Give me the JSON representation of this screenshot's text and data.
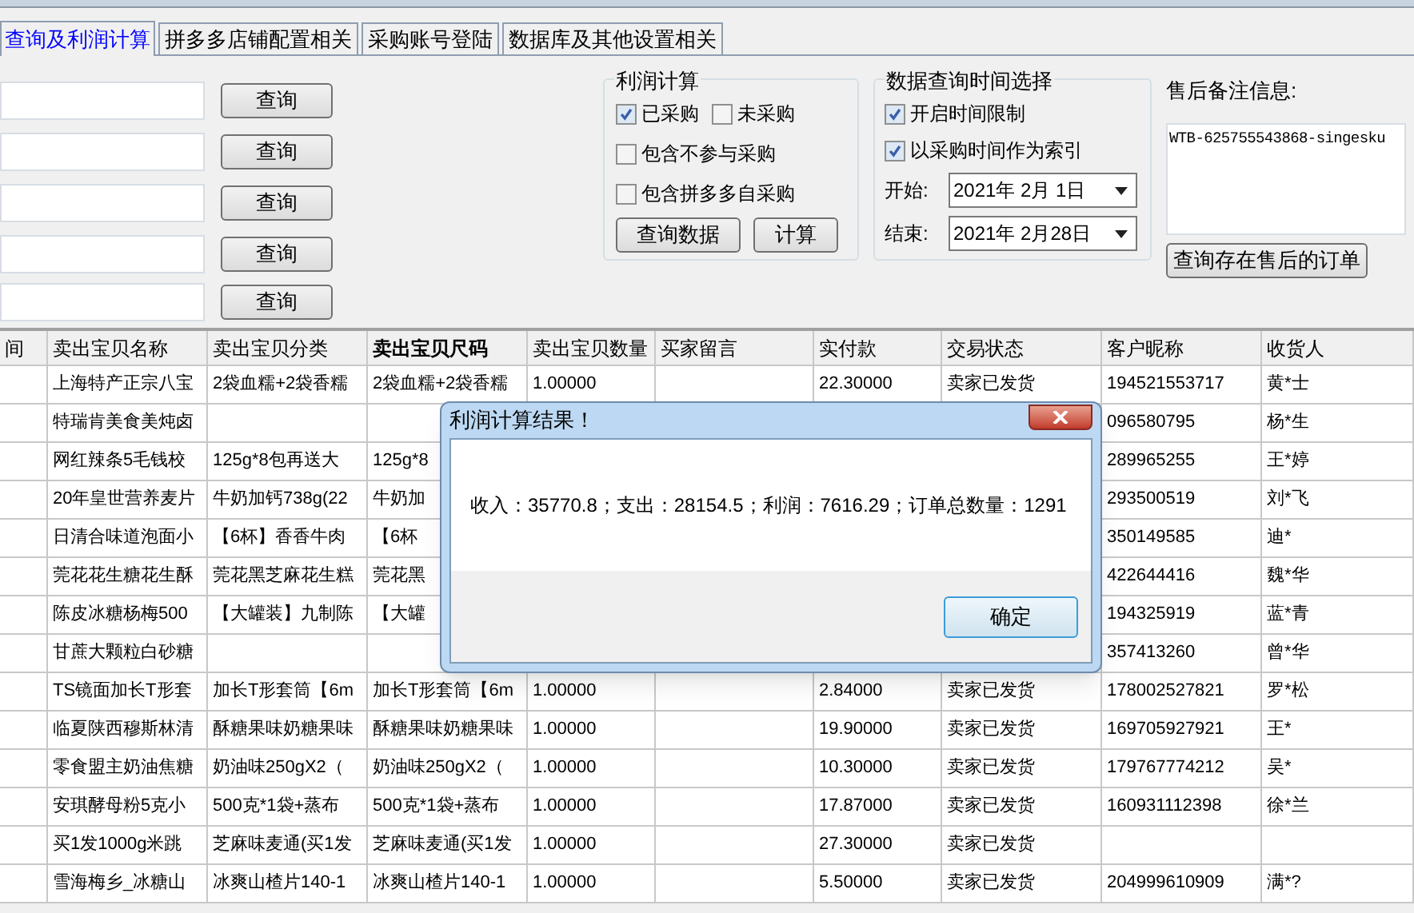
{
  "tabs": [
    {
      "label": "查询及利润计算",
      "selected": true
    },
    {
      "label": "拼多多店铺配置相关",
      "selected": false
    },
    {
      "label": "采购账号登陆",
      "selected": false
    },
    {
      "label": "数据库及其他设置相关",
      "selected": false
    }
  ],
  "query_buttons": [
    "查询",
    "查询",
    "查询",
    "查询",
    "查询"
  ],
  "profit_group": {
    "title": "利润计算",
    "checkboxes": [
      {
        "label": "已采购",
        "checked": true
      },
      {
        "label": "未采购",
        "checked": false
      },
      {
        "label": "包含不参与采购",
        "checked": false
      },
      {
        "label": "包含拼多多自采购",
        "checked": false
      }
    ],
    "buttons": [
      "查询数据",
      "计算"
    ]
  },
  "time_group": {
    "title": "数据查询时间选择",
    "checkboxes": [
      {
        "label": "开启时间限制",
        "checked": true
      },
      {
        "label": "以采购时间作为索引",
        "checked": true
      }
    ],
    "start": {
      "label": "开始:",
      "value": "2021年 2月 1日"
    },
    "end": {
      "label": "结束:",
      "value": "2021年 2月28日"
    }
  },
  "after_sales": {
    "label": "售后备注信息:",
    "note": "WTB-625755543868-singesku",
    "button": "查询存在售后的订单"
  },
  "table": {
    "columns": [
      {
        "label": "间",
        "bold": false
      },
      {
        "label": "卖出宝贝名称",
        "bold": false
      },
      {
        "label": "卖出宝贝分类",
        "bold": false
      },
      {
        "label": "卖出宝贝尺码",
        "bold": true
      },
      {
        "label": "卖出宝贝数量",
        "bold": false
      },
      {
        "label": "买家留言",
        "bold": false
      },
      {
        "label": "实付款",
        "bold": false
      },
      {
        "label": "交易状态",
        "bold": false
      },
      {
        "label": "客户昵称",
        "bold": false
      },
      {
        "label": "收货人",
        "bold": false
      }
    ],
    "rows": [
      [
        null,
        "上海特产正宗八宝",
        "2袋血糯+2袋香糯",
        "2袋血糯+2袋香糯",
        "1.00000",
        null,
        "22.30000",
        "卖家已发货",
        "194521553717",
        "黄*士"
      ],
      [
        null,
        "特瑞肯美食美炖卤",
        null,
        null,
        null,
        null,
        null,
        null,
        "096580795",
        "杨*生"
      ],
      [
        null,
        "网红辣条5毛钱校",
        "125g*8包再送大",
        "125g*8",
        null,
        null,
        null,
        null,
        "289965255",
        "王*婷"
      ],
      [
        null,
        "20年皇世营养麦片",
        "牛奶加钙738g(22",
        "牛奶加",
        null,
        null,
        null,
        null,
        "293500519",
        "刘*飞"
      ],
      [
        null,
        "日清合味道泡面小",
        "【6杯】香香牛肉",
        "【6杯",
        null,
        null,
        null,
        null,
        "350149585",
        "迪*"
      ],
      [
        null,
        "莞花花生糖花生酥",
        "莞花黑芝麻花生糕",
        "莞花黑",
        null,
        null,
        null,
        null,
        "422644416",
        "魏*华"
      ],
      [
        null,
        "陈皮冰糖杨梅500",
        "【大罐装】九制陈",
        "【大罐",
        null,
        null,
        null,
        null,
        "194325919",
        "蓝*青"
      ],
      [
        null,
        "甘蔗大颗粒白砂糖",
        null,
        null,
        null,
        null,
        null,
        null,
        "357413260",
        "曾*华"
      ],
      [
        null,
        "TS镜面加长T形套",
        "加长T形套筒【6m",
        "加长T形套筒【6m",
        "1.00000",
        null,
        "2.84000",
        "卖家已发货",
        "178002527821",
        "罗*松"
      ],
      [
        null,
        "临夏陕西穆斯林清",
        "酥糖果味奶糖果味",
        "酥糖果味奶糖果味",
        "1.00000",
        null,
        "19.90000",
        "卖家已发货",
        "169705927921",
        "王*"
      ],
      [
        null,
        "零食盟主奶油焦糖",
        "奶油味250gX2（",
        "奶油味250gX2（",
        "1.00000",
        null,
        "10.30000",
        "卖家已发货",
        "179767774212",
        "吴*"
      ],
      [
        null,
        "安琪酵母粉5克小",
        "500克*1袋+蒸布",
        "500克*1袋+蒸布",
        "1.00000",
        null,
        "17.87000",
        "卖家已发货",
        "160931112398",
        "徐*兰"
      ],
      [
        null,
        "买1发1000g米跳",
        "芝麻味麦通(买1发",
        "芝麻味麦通(买1发",
        "1.00000",
        null,
        "27.30000",
        "卖家已发货",
        null,
        null
      ],
      [
        null,
        "雪海梅乡_冰糖山",
        "冰爽山楂片140-1",
        "冰爽山楂片140-1",
        "1.00000",
        null,
        "5.50000",
        "卖家已发货",
        "204999610909",
        "满*?"
      ]
    ]
  },
  "dialog": {
    "title": "利润计算结果！",
    "message": "收入：35770.8；支出：28154.5；利润：7616.29；订单总数量：1291",
    "button": "确定"
  }
}
